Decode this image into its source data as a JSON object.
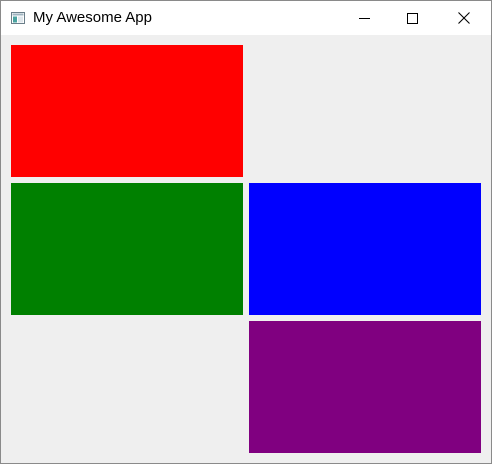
{
  "window": {
    "title": "My Awesome App"
  },
  "titlebar": {
    "app_icon": "app-window-icon",
    "buttons": {
      "minimize_icon": "minimize-icon",
      "maximize_icon": "maximize-icon",
      "close_icon": "close-icon"
    }
  },
  "panels": [
    {
      "name": "red-panel",
      "color": "#ff0000"
    },
    {
      "name": "green-panel",
      "color": "#008000"
    },
    {
      "name": "blue-panel",
      "color": "#0000ff"
    },
    {
      "name": "purple-panel",
      "color": "#800080"
    }
  ]
}
